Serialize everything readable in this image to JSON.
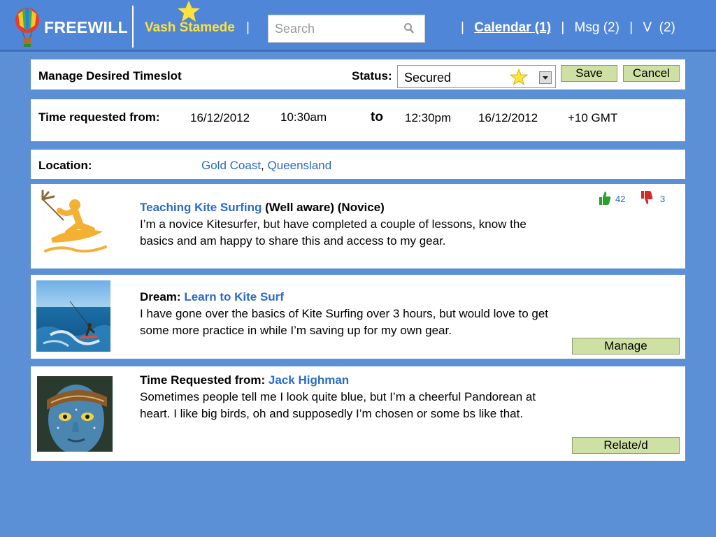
{
  "header": {
    "logo_text": "FREEWILL",
    "user_name": "Vash Stamede",
    "user_sep": "|",
    "search_placeholder": "Search",
    "nav": [
      {
        "label": "Calendar (1)",
        "active": true
      },
      {
        "label": "Msg (2)",
        "active": false
      },
      {
        "label": "V  (2)",
        "active": false
      }
    ],
    "nav_sep": "|"
  },
  "manage": {
    "title": "Manage Desired Timeslot",
    "status_label": "Status:",
    "status_value": "Secured",
    "save_label": "Save",
    "cancel_label": "Cancel"
  },
  "time": {
    "label": "Time requested from:",
    "from_date": "16/12/2012",
    "from_time": "10:30am",
    "to_label": "to",
    "to_time": "12:30pm",
    "to_date": "16/12/2012",
    "timezone": "+10 GMT"
  },
  "location": {
    "label": "Location:",
    "city": "Gold Coast",
    "sep": ",",
    "state": "Queensland"
  },
  "skill": {
    "title_link": "Teaching Kite Surfing",
    "title_rest": " (Well aware) (Novice)",
    "description": "I’m a novice Kitesurfer, but have completed a couple of lessons, know the basics and am happy to share this and access to my gear.",
    "likes": "42",
    "dislikes": "3"
  },
  "dream": {
    "label": "Dream:",
    "title_link": "Learn to Kite Surf",
    "description": "I have gone over the basics of Kite Surfing over 3 hours, but would love to get some more practice in while I’m saving up for my own gear.",
    "button_label": "Manage"
  },
  "request": {
    "label": "Time Requested from:",
    "person_link": "Jack Highman",
    "description": "Sometimes people tell me I look quite blue, but I’m a cheerful Pandorean at heart. I like big birds, oh and supposedly I’m chosen or some bs like that.",
    "button_label": "Relate/d"
  },
  "colors": {
    "background": "#5b8fd6",
    "header": "#4f86d8",
    "link": "#2a6bc9",
    "user_name": "#ffe23a",
    "button": "#cfe0a4",
    "like": "#2e9e2e",
    "dislike": "#d42a2a"
  }
}
